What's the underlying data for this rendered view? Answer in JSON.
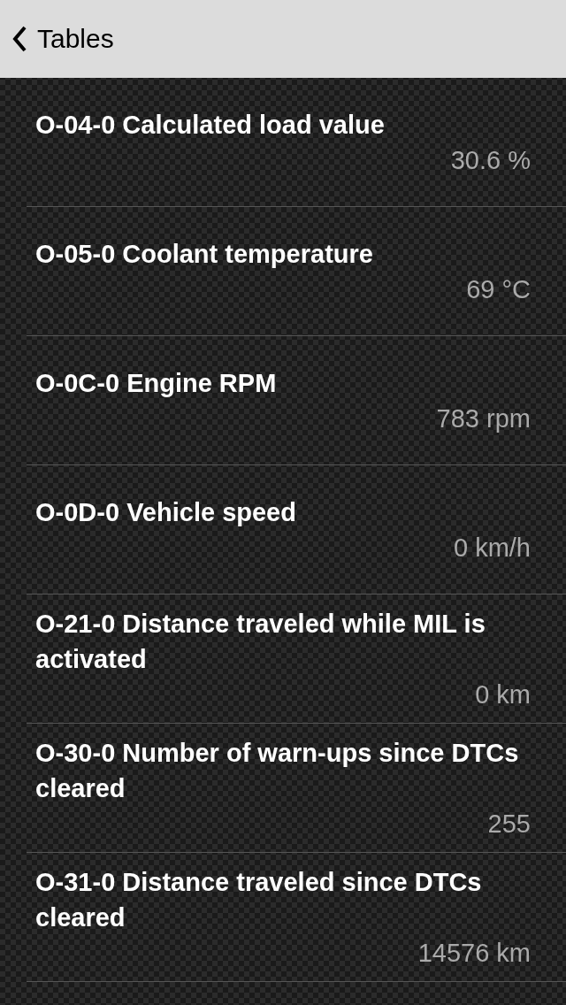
{
  "nav": {
    "back_label": "Tables"
  },
  "rows": [
    {
      "title": "O-04-0 Calculated load value",
      "value": "30.6 %"
    },
    {
      "title": "O-05-0 Coolant temperature",
      "value": "69 °C"
    },
    {
      "title": "O-0C-0 Engine RPM",
      "value": "783 rpm"
    },
    {
      "title": "O-0D-0 Vehicle speed",
      "value": "0 km/h"
    },
    {
      "title": "O-21-0 Distance traveled while MIL is activated",
      "value": "0 km"
    },
    {
      "title": "O-30-0 Number of warn-ups since DTCs cleared",
      "value": "255"
    },
    {
      "title": "O-31-0 Distance traveled since DTCs cleared",
      "value": "14576 km"
    }
  ]
}
